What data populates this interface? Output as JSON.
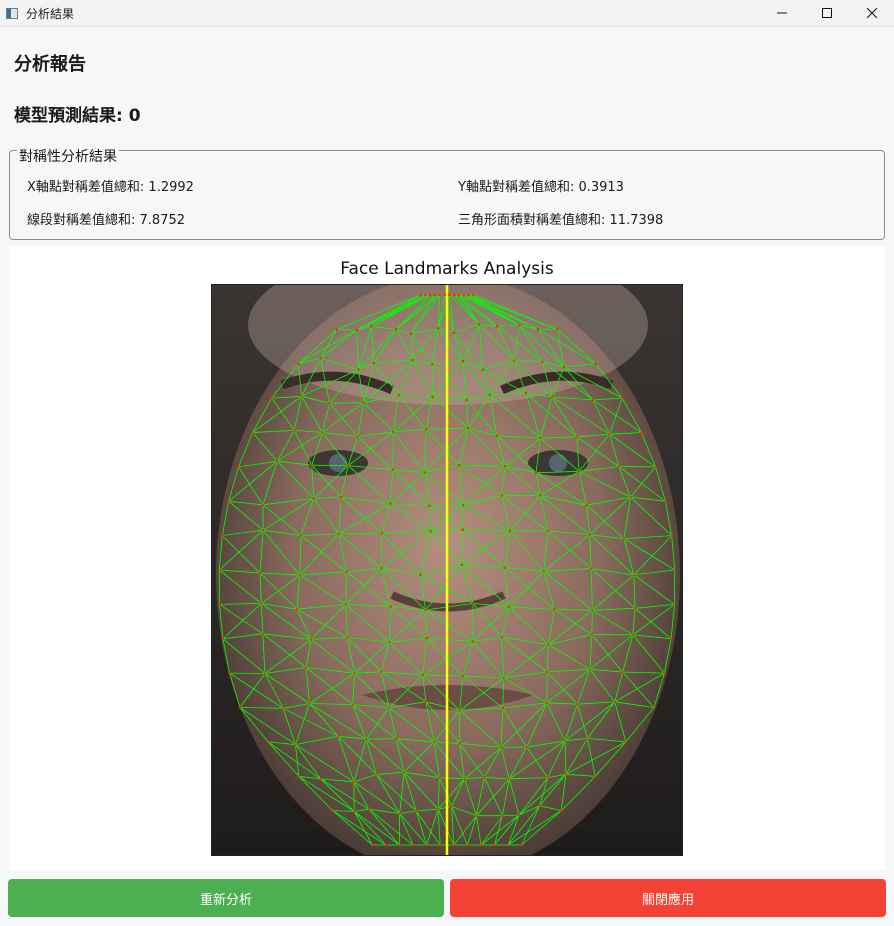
{
  "window": {
    "title": "分析結果"
  },
  "report": {
    "title": "分析報告",
    "prediction_label": "模型預測結果: 0"
  },
  "symmetry": {
    "legend": "對稱性分析結果",
    "x_sum": "X軸點對稱差值總和: 1.2992",
    "y_sum": "Y軸點對稱差值總和: 0.3913",
    "segment_sum": "線段對稱差值總和: 7.8752",
    "triangle_sum": "三角形面積對稱差值總和: 11.7398"
  },
  "figure": {
    "title": "Face Landmarks Analysis",
    "mesh_color": "#00ff00",
    "midline_color": "#ffff00",
    "landmark_color": "#ff2a00"
  },
  "buttons": {
    "reanalyze": "重新分析",
    "close": "關閉應用"
  },
  "colors": {
    "reanalyze": "#4caf50",
    "close": "#f44336"
  }
}
